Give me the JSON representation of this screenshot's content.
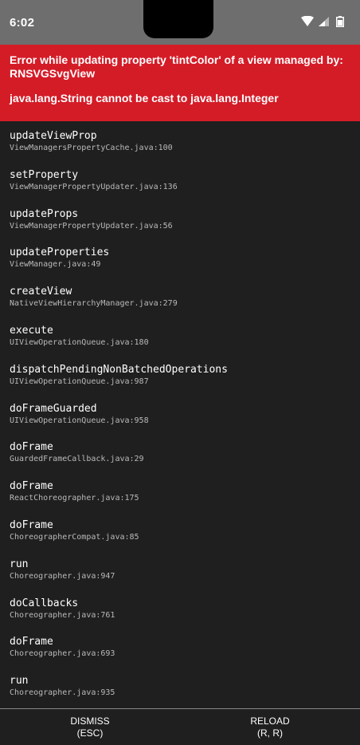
{
  "status_bar": {
    "time": "6:02",
    "icons": [
      "wifi-icon",
      "signal-icon",
      "battery-icon"
    ]
  },
  "error": {
    "message": "Error while updating property 'tintColor' of a view managed by: RNSVGSvgView",
    "detail": "java.lang.String cannot be cast to java.lang.Integer",
    "background_color": "#d41c27"
  },
  "stack": [
    {
      "method": "updateViewProp",
      "file": "ViewManagersPropertyCache.java:100"
    },
    {
      "method": "setProperty",
      "file": "ViewManagerPropertyUpdater.java:136"
    },
    {
      "method": "updateProps",
      "file": "ViewManagerPropertyUpdater.java:56"
    },
    {
      "method": "updateProperties",
      "file": "ViewManager.java:49"
    },
    {
      "method": "createView",
      "file": "NativeViewHierarchyManager.java:279"
    },
    {
      "method": "execute",
      "file": "UIViewOperationQueue.java:180"
    },
    {
      "method": "dispatchPendingNonBatchedOperations",
      "file": "UIViewOperationQueue.java:987"
    },
    {
      "method": "doFrameGuarded",
      "file": "UIViewOperationQueue.java:958"
    },
    {
      "method": "doFrame",
      "file": "GuardedFrameCallback.java:29"
    },
    {
      "method": "doFrame",
      "file": "ReactChoreographer.java:175"
    },
    {
      "method": "doFrame",
      "file": "ChoreographerCompat.java:85"
    },
    {
      "method": "run",
      "file": "Choreographer.java:947"
    },
    {
      "method": "doCallbacks",
      "file": "Choreographer.java:761"
    },
    {
      "method": "doFrame",
      "file": "Choreographer.java:693"
    },
    {
      "method": "run",
      "file": "Choreographer.java:935"
    }
  ],
  "buttons": {
    "dismiss": {
      "label": "DISMISS",
      "shortcut": "(ESC)"
    },
    "reload": {
      "label": "RELOAD",
      "shortcut": "(R, R)"
    }
  }
}
